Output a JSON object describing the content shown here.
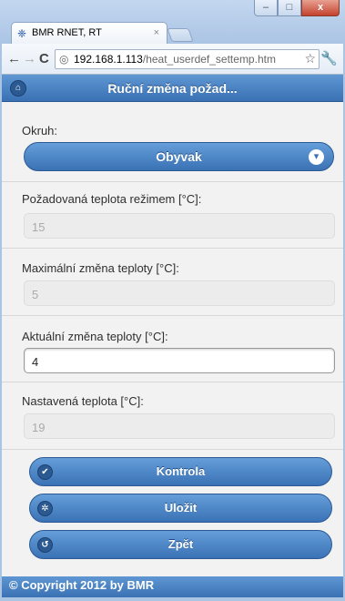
{
  "browser": {
    "tab_title": "BMR RNET, RT",
    "tab_close": "×",
    "url_host": "192.168.1.113",
    "url_path": "/heat_userdef_settemp.htm",
    "window_buttons": {
      "minimize": "–",
      "maximize": "□",
      "close": "x"
    }
  },
  "header": {
    "title": "Ruční změna požad..."
  },
  "fields": {
    "okruh_label": "Okruh:",
    "okruh_value": "Obyvak",
    "pozadovana_label": "Požadovaná teplota režimem [°C]:",
    "pozadovana_value": "15",
    "max_zmena_label": "Maximální změna teploty [°C]:",
    "max_zmena_value": "5",
    "aktualni_label": "Aktuální změna teploty [°C]:",
    "aktualni_value": "4",
    "nastavena_label": "Nastavená teplota [°C]:",
    "nastavena_value": "19"
  },
  "buttons": {
    "kontrola": "Kontrola",
    "ulozit": "Uložit",
    "zpet": "Zpět"
  },
  "footer": {
    "copyright": "© Copyright 2012 by BMR"
  },
  "colors": {
    "accent": "#3a72b5",
    "page_bg": "#f2f2f2"
  }
}
